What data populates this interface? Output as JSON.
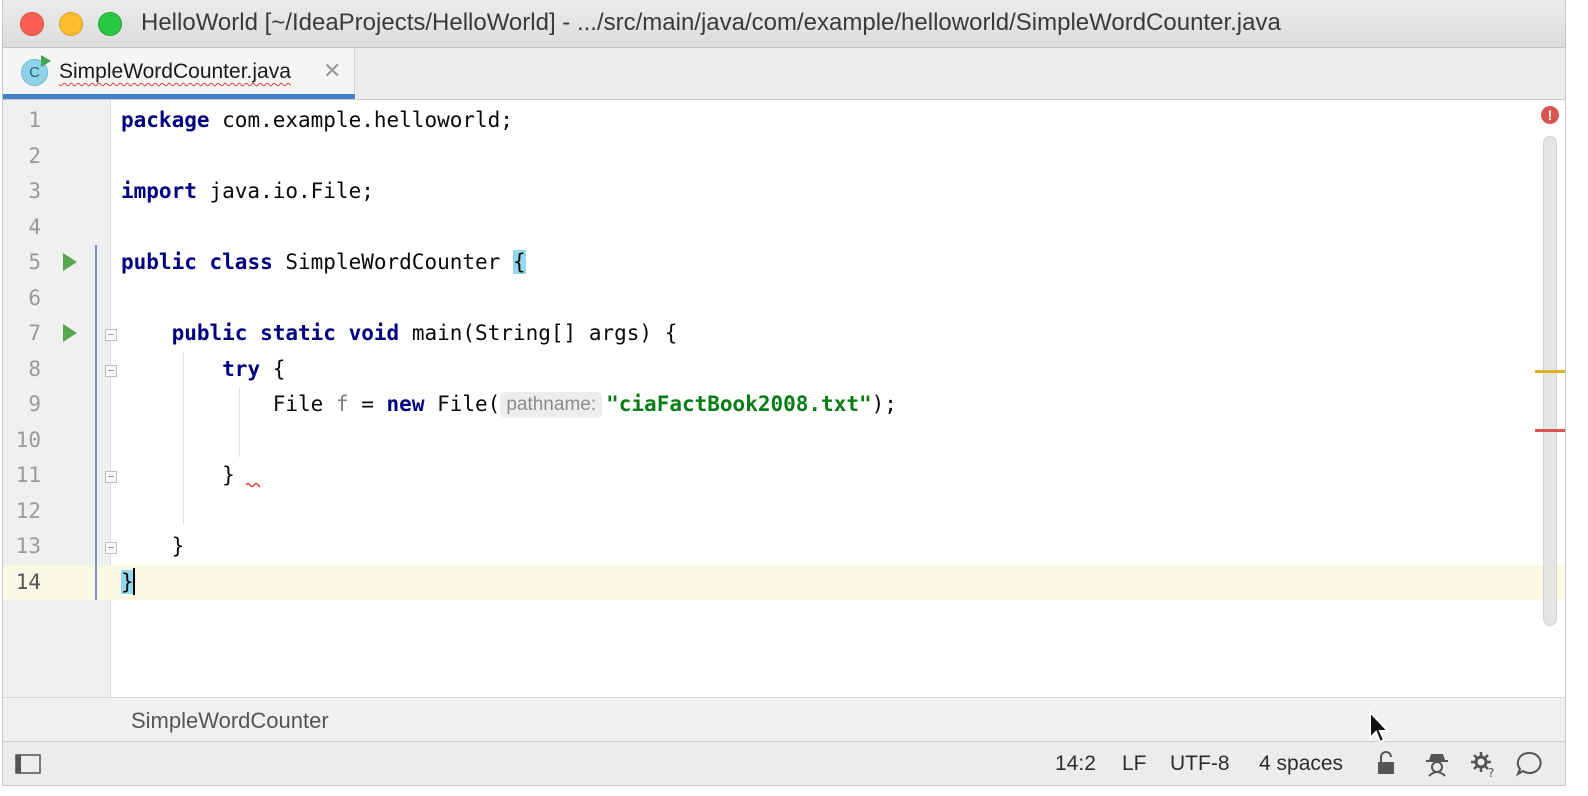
{
  "window": {
    "title": "HelloWorld [~/IdeaProjects/HelloWorld] - .../src/main/java/com/example/helloworld/SimpleWordCounter.java"
  },
  "tabs": [
    {
      "label": "SimpleWordCounter.java",
      "icon": "class-icon",
      "icon_letter": "C",
      "active": true,
      "has_error": true
    }
  ],
  "editor": {
    "line_numbers": [
      "1",
      "2",
      "3",
      "4",
      "5",
      "6",
      "7",
      "8",
      "9",
      "10",
      "11",
      "12",
      "13",
      "14"
    ],
    "current_line": 14,
    "code": {
      "l1": {
        "kw": "package",
        "rest": " com.example.helloworld;"
      },
      "l3": {
        "kw": "import",
        "rest": " java.io.File;"
      },
      "l5": {
        "kw1": "public",
        "kw2": "class",
        "name": " SimpleWordCounter ",
        "brace": "{"
      },
      "l7": {
        "kw1": "public",
        "kw2": "static",
        "kw3": "void",
        "rest": " main(String[] args) {"
      },
      "l8": {
        "kw": "try",
        "rest": " {"
      },
      "l9": {
        "type": "File ",
        "var": "f",
        "eq": " = ",
        "kw": "new",
        "call": " File(",
        "hint": "pathname:",
        "str": "\"ciaFactBook2008.txt\"",
        "end": ");"
      },
      "l11": {
        "text": "}"
      },
      "l13": {
        "text": "}"
      },
      "l14": {
        "text": "}"
      }
    },
    "problems_icon": "error-indicator-icon"
  },
  "breadcrumb": {
    "label": "SimpleWordCounter"
  },
  "status_bar": {
    "position": "14:2",
    "line_separator": "LF",
    "encoding": "UTF-8",
    "indent": "4 spaces"
  },
  "colors": {
    "accent": "#4083c9",
    "keyword": "#000080",
    "string": "#067d17",
    "error": "#d9534f",
    "warning": "#e0b020",
    "current_line": "#fcf8e6"
  }
}
